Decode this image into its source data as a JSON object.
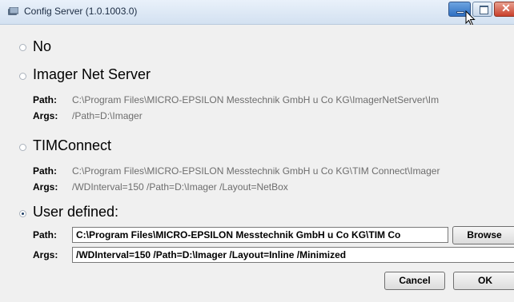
{
  "window": {
    "title": "Config Server (1.0.1003.0)"
  },
  "options": {
    "no": {
      "label": "No",
      "selected": false
    },
    "imager_net_server": {
      "label": "Imager Net Server",
      "selected": false,
      "path": "C:\\Program Files\\MICRO-EPSILON Messtechnik GmbH u Co KG\\ImagerNetServer\\Im",
      "args": "/Path=D:\\Imager"
    },
    "timconnect": {
      "label": "TIMConnect",
      "selected": false,
      "path": "C:\\Program Files\\MICRO-EPSILON Messtechnik GmbH u Co KG\\TIM Connect\\Imager",
      "args": "/WDInterval=150 /Path=D:\\Imager /Layout=NetBox"
    },
    "user_defined": {
      "label": "User defined:",
      "selected": true,
      "path": "C:\\Program Files\\MICRO-EPSILON Messtechnik GmbH u Co KG\\TIM Co",
      "args": "/WDInterval=150 /Path=D:\\Imager /Layout=Inline /Minimized"
    }
  },
  "labels": {
    "path": "Path:",
    "args": "Args:"
  },
  "buttons": {
    "browse": "Browse",
    "cancel": "Cancel",
    "ok": "OK"
  }
}
